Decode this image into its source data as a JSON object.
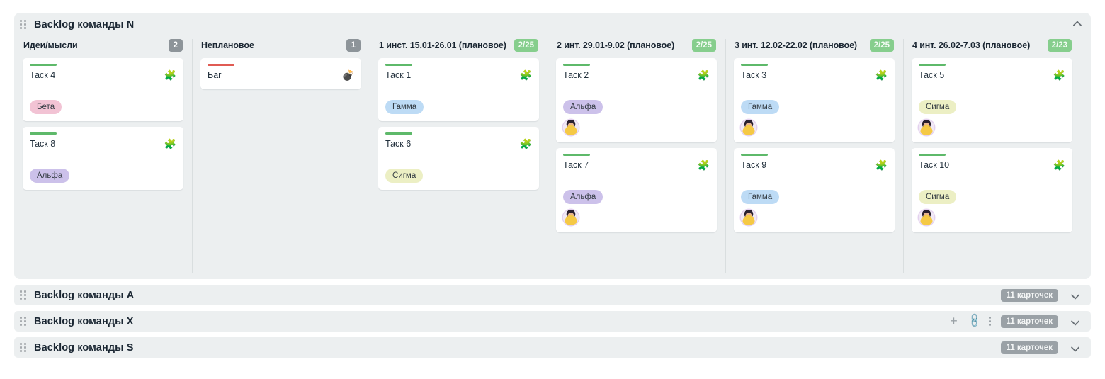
{
  "board": {
    "expanded_lane": {
      "title": "Backlog команды N",
      "drag_handle_icon": "drag-handle-icon",
      "collapse_icon": "chevron-up-icon",
      "columns": [
        {
          "title": "Идеи/мысли",
          "badge": "2",
          "badge_style": "gray",
          "cards": [
            {
              "bar": "green",
              "title": "Таск 4",
              "type_icon": "🧩",
              "type_icon_name": "puzzle-icon",
              "tag": "Бета",
              "tag_style": "beta",
              "avatar": false
            },
            {
              "bar": "green",
              "title": "Таск 8",
              "type_icon": "🧩",
              "type_icon_name": "puzzle-icon",
              "tag": "Альфа",
              "tag_style": "alfa",
              "avatar": false
            }
          ]
        },
        {
          "title": "Неплановое",
          "badge": "1",
          "badge_style": "gray",
          "cards": [
            {
              "bar": "red",
              "title": "Баг",
              "type_icon": "💣",
              "type_icon_name": "bomb-icon",
              "tag": null,
              "tag_style": null,
              "avatar": false
            }
          ]
        },
        {
          "title": "1 инст. 15.01-26.01 (плановое)",
          "badge": "2/25",
          "badge_style": "green",
          "cards": [
            {
              "bar": "green",
              "title": "Таск 1",
              "type_icon": "🧩",
              "type_icon_name": "puzzle-icon",
              "tag": "Гамма",
              "tag_style": "gamma",
              "avatar": false
            },
            {
              "bar": "green",
              "title": "Таск 6",
              "type_icon": "🧩",
              "type_icon_name": "puzzle-icon",
              "tag": "Сигма",
              "tag_style": "sigma",
              "avatar": false
            }
          ]
        },
        {
          "title": "2 инт. 29.01-9.02 (плановое)",
          "badge": "2/25",
          "badge_style": "green",
          "cards": [
            {
              "bar": "green",
              "title": "Таск 2",
              "type_icon": "🧩",
              "type_icon_name": "puzzle-icon",
              "tag": "Альфа",
              "tag_style": "alfa",
              "avatar": true
            },
            {
              "bar": "green",
              "title": "Таск 7",
              "type_icon": "🧩",
              "type_icon_name": "puzzle-icon",
              "tag": "Альфа",
              "tag_style": "alfa",
              "avatar": true
            }
          ]
        },
        {
          "title": "3 инт. 12.02-22.02 (плановое)",
          "badge": "2/25",
          "badge_style": "green",
          "cards": [
            {
              "bar": "green",
              "title": "Таск 3",
              "type_icon": "🧩",
              "type_icon_name": "puzzle-icon",
              "tag": "Гамма",
              "tag_style": "gamma",
              "avatar": true
            },
            {
              "bar": "green",
              "title": "Таск 9",
              "type_icon": "🧩",
              "type_icon_name": "puzzle-icon",
              "tag": "Гамма",
              "tag_style": "gamma",
              "avatar": true
            }
          ]
        },
        {
          "title": "4 инт. 26.02-7.03 (плановое)",
          "badge": "2/23",
          "badge_style": "green",
          "cards": [
            {
              "bar": "green",
              "title": "Таск 5",
              "type_icon": "🧩",
              "type_icon_name": "puzzle-icon",
              "tag": "Сигма",
              "tag_style": "sigma",
              "avatar": true
            },
            {
              "bar": "green",
              "title": "Таск 10",
              "type_icon": "🧩",
              "type_icon_name": "puzzle-icon",
              "tag": "Сигма",
              "tag_style": "sigma",
              "avatar": true
            }
          ]
        }
      ]
    },
    "collapsed_lanes": [
      {
        "title": "Backlog команды A",
        "count": "11 карточек",
        "expand_icon": "chevron-down-icon",
        "show_actions": false,
        "actions": {
          "add": "+",
          "link": "🔗",
          "menu": "more-vertical"
        }
      },
      {
        "title": "Backlog команды X",
        "count": "11 карточек",
        "expand_icon": "chevron-down-icon",
        "show_actions": true,
        "actions": {
          "add": "+",
          "link": "🔗",
          "menu": "more-vertical"
        }
      },
      {
        "title": "Backlog команды S",
        "count": "11 карточек",
        "expand_icon": "chevron-down-icon",
        "show_actions": false,
        "actions": {
          "add": "+",
          "link": "🔗",
          "menu": "more-vertical"
        }
      }
    ]
  },
  "colors": {
    "panel_bg": "#eceff0",
    "card_bg": "#ffffff",
    "bar_green": "#5eb96a",
    "bar_red": "#e05b53",
    "badge_gray": "#8d9499",
    "badge_green": "#86ce8d",
    "tag_beta": "#f2c3d4",
    "tag_alfa": "#ccc1ea",
    "tag_gamma": "#bddbf5",
    "tag_sigma": "#ecefc4"
  }
}
